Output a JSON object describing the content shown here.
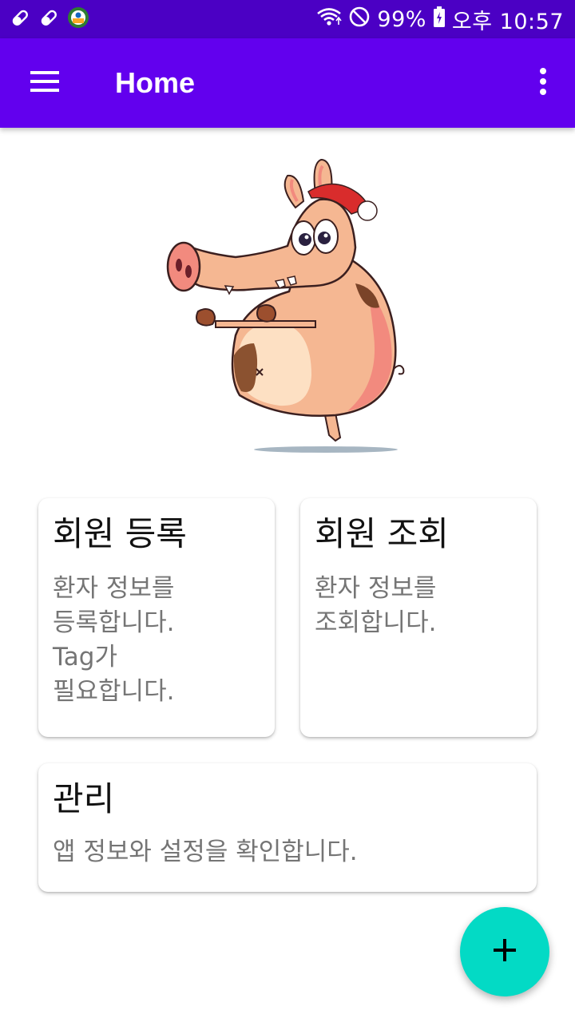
{
  "status_bar": {
    "battery": "99%",
    "time": "오후 10:57",
    "icons": [
      "pill-icon",
      "pill-icon",
      "app-badge-icon",
      "wifi-icon",
      "do-not-disturb-icon",
      "battery-icon"
    ]
  },
  "app_bar": {
    "title": "Home",
    "menu_icon": "hamburger-menu-icon",
    "overflow_icon": "more-vert-icon"
  },
  "cards": {
    "register": {
      "title": "회원 등록",
      "description": "환자 정보를\n등록합니다.\nTag가\n필요합니다."
    },
    "lookup": {
      "title": "회원 조회",
      "description": "환자 정보를\n조회합니다."
    },
    "manage": {
      "title": "관리",
      "description": "앱 정보와 설정을 확인합니다."
    }
  },
  "fab": {
    "icon": "plus-icon"
  },
  "colors": {
    "status_bar": "#4b00c4",
    "app_bar": "#6200ee",
    "fab": "#03dac5",
    "card_title": "#111111",
    "card_desc": "#757575"
  }
}
